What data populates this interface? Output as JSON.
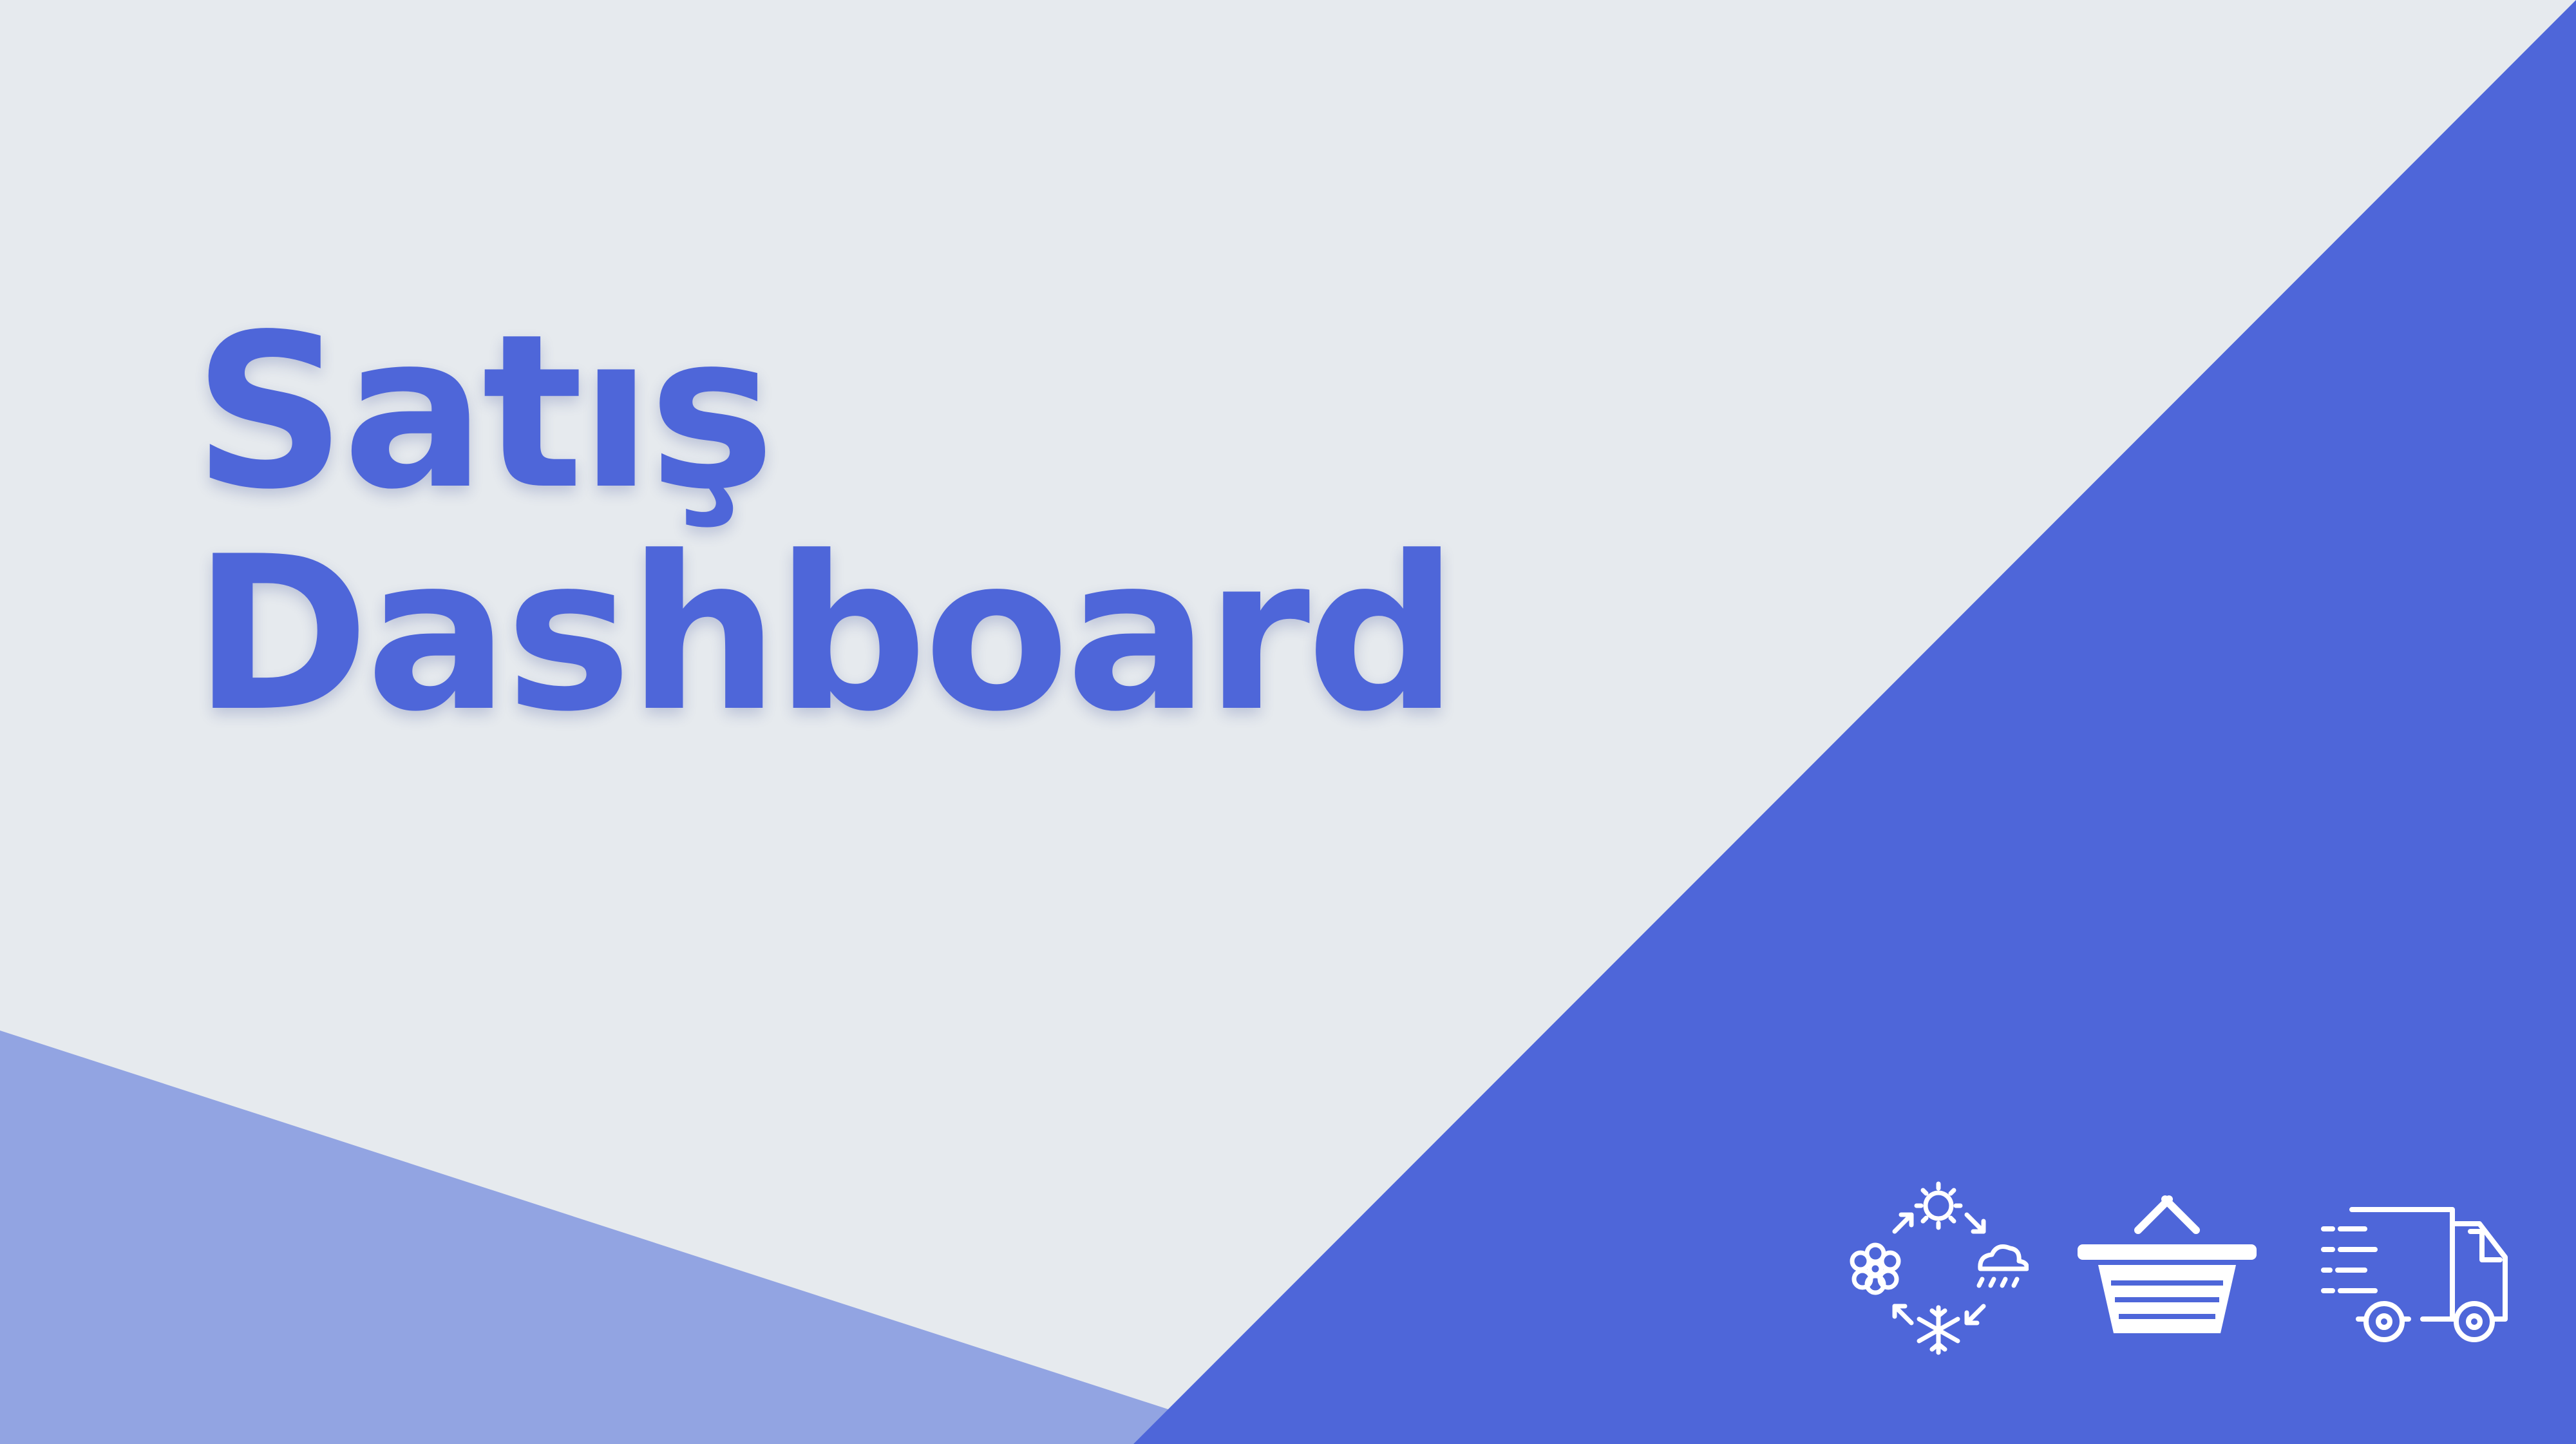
{
  "title": {
    "line1": "Satış",
    "line2": "Dashboard"
  },
  "colors": {
    "background": "#e6eaee",
    "accent": "#4e66d9",
    "accent_light": "#92a4e2",
    "icon": "#ffffff"
  },
  "icons": [
    "seasons-cycle-icon",
    "shopping-basket-icon",
    "delivery-truck-icon"
  ]
}
